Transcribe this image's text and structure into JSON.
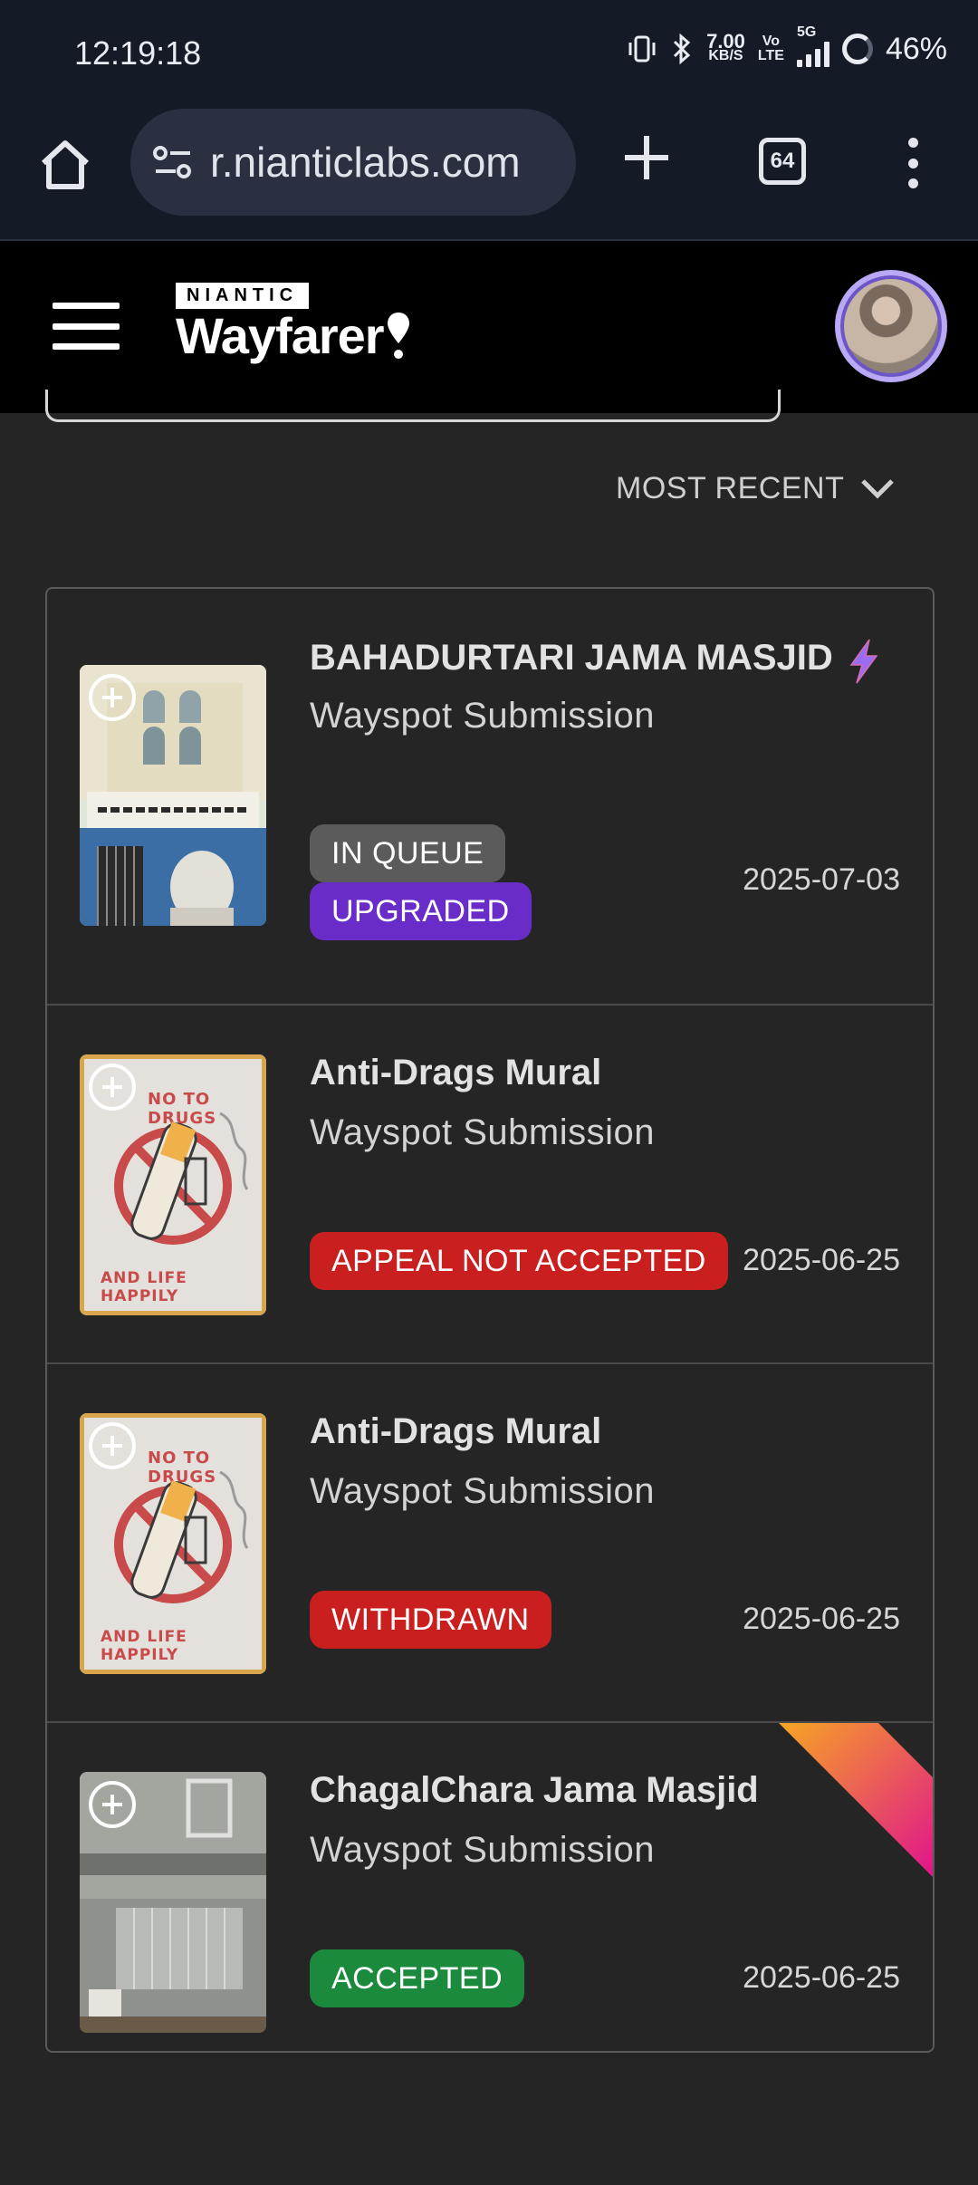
{
  "status_bar": {
    "time": "12:19:18",
    "net_speed_top": "7.00",
    "net_speed_bottom": "KB/S",
    "volte_top": "Vo",
    "volte_bottom": "LTE",
    "network": "5G",
    "battery": "46%"
  },
  "browser": {
    "url": "r.nianticlabs.com",
    "tab_count": "64"
  },
  "header": {
    "brand_badge": "NIANTIC",
    "brand_name": "Wayfarer"
  },
  "sort": {
    "label": "MOST RECENT"
  },
  "submissions": [
    {
      "title": "BAHADURTARI JAMA MASJID",
      "subtitle": "Wayspot Submission",
      "badges": [
        "IN QUEUE",
        "UPGRADED"
      ],
      "date": "2025-07-03"
    },
    {
      "title": "Anti-Drags Mural",
      "subtitle": "Wayspot Submission",
      "badges": [
        "APPEAL NOT ACCEPTED"
      ],
      "date": "2025-06-25",
      "thumb_text": [
        "NO TO DRUGS",
        "AND LIFE HAPPILY"
      ]
    },
    {
      "title": "Anti-Drags Mural",
      "subtitle": "Wayspot Submission",
      "badges": [
        "WITHDRAWN"
      ],
      "date": "2025-06-25",
      "thumb_text": [
        "NO TO DRUGS",
        "AND LIFE HAPPILY"
      ]
    },
    {
      "title": "ChagalChara Jama Masjid",
      "subtitle": "Wayspot Submission",
      "badges": [
        "ACCEPTED"
      ],
      "date": "2025-06-25"
    }
  ],
  "colors": {
    "badge_queue": "#5b5b5b",
    "badge_upgraded": "#6a2cc9",
    "badge_rejected": "#c91f1f",
    "badge_accepted": "#1b8a3c",
    "upgrade_bolt": "#9b6cf0"
  }
}
